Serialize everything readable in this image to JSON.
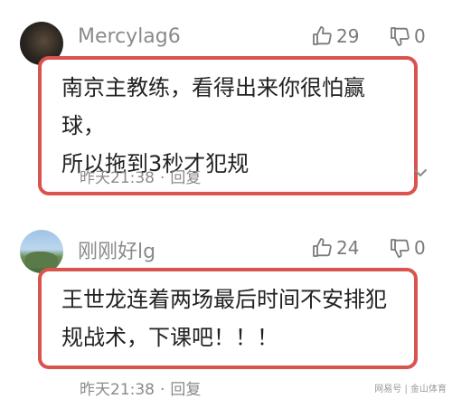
{
  "comments": [
    {
      "username": "Mercylag6",
      "likes": "29",
      "dislikes": "0",
      "text_line1": "南京主教练，看得出来你很怕赢球，",
      "text_line2": "所以拖到3秒才犯规",
      "time": "昨天21:38",
      "reply": "回复"
    },
    {
      "username": "刚刚好lg",
      "likes": "24",
      "dislikes": "0",
      "text_line1": "王世龙连着两场最后时间不安排犯",
      "text_line2": "规战术，下课吧！！！",
      "time": "昨天21:38",
      "reply": "回复"
    }
  ],
  "colors": {
    "highlight_border": "#d9534f",
    "meta_text": "#8a8a8a"
  },
  "watermark": "网易号 | 金山体育"
}
